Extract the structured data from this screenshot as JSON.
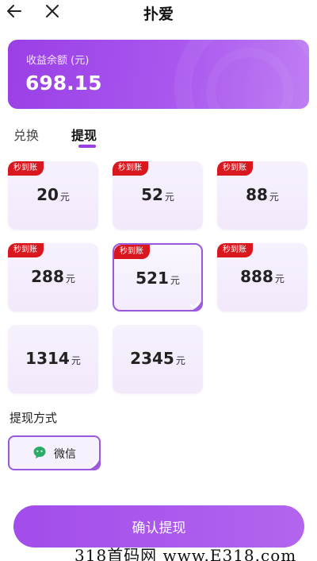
{
  "header": {
    "title": "扑爱",
    "back_icon": "arrow-left-icon",
    "close_icon": "close-icon"
  },
  "balance": {
    "label": "收益余额 (元)",
    "amount": "698.15"
  },
  "tabs": [
    {
      "label": "兑换",
      "active": false
    },
    {
      "label": "提现",
      "active": true
    }
  ],
  "options": [
    {
      "value": "20",
      "unit": "元",
      "badge": "秒到账",
      "selected": false
    },
    {
      "value": "52",
      "unit": "元",
      "badge": "秒到账",
      "selected": false
    },
    {
      "value": "88",
      "unit": "元",
      "badge": "秒到账",
      "selected": false
    },
    {
      "value": "288",
      "unit": "元",
      "badge": "秒到账",
      "selected": false
    },
    {
      "value": "521",
      "unit": "元",
      "badge": "秒到账",
      "selected": true
    },
    {
      "value": "888",
      "unit": "元",
      "badge": "秒到账",
      "selected": false
    },
    {
      "value": "1314",
      "unit": "元",
      "badge": "",
      "selected": false
    },
    {
      "value": "2345",
      "unit": "元",
      "badge": "",
      "selected": false
    }
  ],
  "method": {
    "label": "提现方式",
    "selected": {
      "name": "微信",
      "icon": "wechat-icon"
    }
  },
  "confirm_label": "确认提现",
  "watermark": "318首码网 www.E318.com",
  "colors": {
    "accent": "#9a3fe6",
    "badge": "#d8171e",
    "wechat": "#2aae67"
  }
}
